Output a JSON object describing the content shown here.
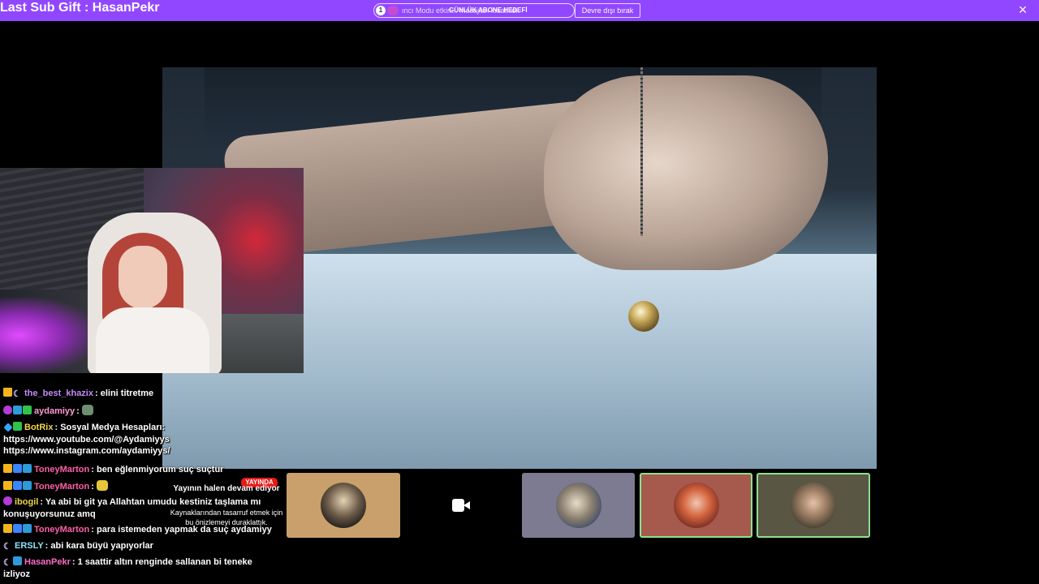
{
  "topbar": {
    "sub_gift": "Last Sub Gift : HasanPekr",
    "notice_number": "1",
    "notice_text": "ıncı Modu etkin... mesajları kısaltıldı.",
    "goal_text": "GÜNLÜK ABONE HEDEFİ",
    "button_label": "Devre dışı bırak",
    "close_glyph": "×",
    "accent_color": "#9147ff"
  },
  "chat": {
    "messages": [
      {
        "badges": [
          "crown",
          "moon"
        ],
        "user": "the_best_khazix",
        "user_color": "#c58af9",
        "text": "elini titretme"
      },
      {
        "badges": [
          "gift",
          "sub",
          "mod"
        ],
        "user": "aydamiyy",
        "user_color": "#ff9bd2",
        "text": "",
        "emote": "emote"
      },
      {
        "badges": [
          "sword",
          "mod"
        ],
        "user": "BotRix",
        "user_color": "#f2d64a",
        "text": "Sosyal Medya Hesapları: https://www.youtube.com/@Aydamiyys https://www.instagram.com/aydamiyys/"
      },
      {
        "badges": [
          "crown",
          "prime",
          "sub"
        ],
        "user": "ToneyMarton",
        "user_color": "#ff5fa8",
        "text": "ben eğlenmiyorum suç suçtur"
      },
      {
        "badges": [
          "crown",
          "prime",
          "sub"
        ],
        "user": "ToneyMarton",
        "user_color": "#ff5fa8",
        "text": "",
        "emote": "emote"
      },
      {
        "badges": [
          "gift"
        ],
        "user": "ibogil",
        "user_color": "#f2d64a",
        "text": "Ya abi bi git ya Allahtan umudu kestiniz taşlama mı konuşuyorsunuz amq"
      },
      {
        "badges": [
          "crown",
          "prime",
          "sub"
        ],
        "user": "ToneyMarton",
        "user_color": "#ff5fa8",
        "text": "para istemeden yapmak da suç aydamiyy"
      },
      {
        "badges": [
          "moon"
        ],
        "user": "ERSLY",
        "user_color": "#8de3f5",
        "text": "abi kara büyü yapıyorlar"
      },
      {
        "badges": [
          "moon",
          "sub"
        ],
        "user": "HasanPekr",
        "user_color": "#ff6cc9",
        "text": "1 saattir altın renginde sallanan bi teneke izliyoz"
      }
    ]
  },
  "live_overlay": {
    "badge": "YAYINDA",
    "title": "Yayının halen devam ediyor",
    "subtitle": "Kaynaklarından tasarruf etmek için bu önizlemeyi duraklattık."
  },
  "tiles": [
    {
      "kind": "avatar",
      "bg": "#c9a06c",
      "border": "#c9a06c",
      "icon": "avatar-man-icon"
    },
    {
      "kind": "camera",
      "bg": "#000000",
      "border": "#000000",
      "icon": "video-camera-icon"
    },
    {
      "kind": "avatar",
      "bg": "#7c7b92",
      "border": "#7c7b92",
      "icon": "avatar-sloth-icon"
    },
    {
      "kind": "avatar",
      "bg": "#a65a4e",
      "border": "#8ee08f",
      "icon": "avatar-redhead-icon"
    },
    {
      "kind": "avatar",
      "bg": "#595743",
      "border": "#8ee08f",
      "icon": "avatar-man-glasses-icon"
    }
  ]
}
